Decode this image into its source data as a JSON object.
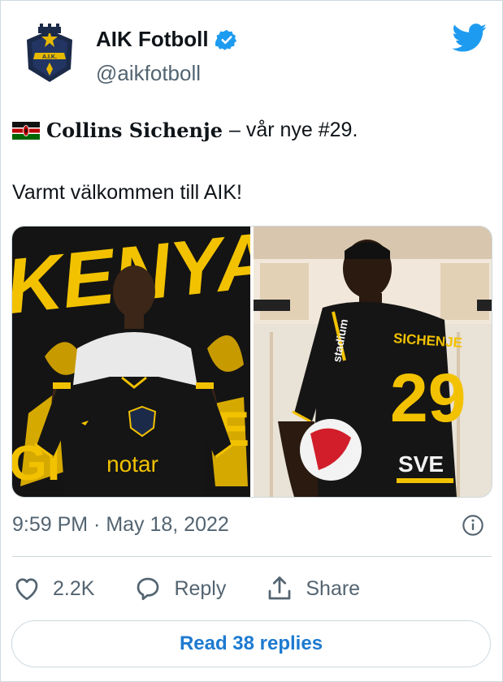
{
  "author": {
    "name": "AIK Fotboll",
    "handle": "@aikfotboll",
    "verified_icon": "verified-badge-icon"
  },
  "tweet": {
    "flag_icon": "kenya-flag-icon",
    "player_name": "Collins Sichenje",
    "line1_rest": "– vår nye #29.",
    "line2": "Varmt välkommen till AIK!"
  },
  "media": {
    "left": {
      "banner_text": "KENYA",
      "shirt_sponsor": "notar"
    },
    "right": {
      "shirt_name": "SICHENJE",
      "shirt_number": "29",
      "sleeve_text": "stadium",
      "sponsor_fragment": "SVE"
    }
  },
  "meta": {
    "timestamp": "9:59 PM · May 18, 2022"
  },
  "actions": {
    "likes": "2.2K",
    "reply_label": "Reply",
    "share_label": "Share"
  },
  "read_replies": "Read 38 replies",
  "colors": {
    "link_blue": "#1d7ad0",
    "twitter_blue": "#1d9bf0",
    "secondary": "#536471",
    "border": "#cfd9de",
    "aik_yellow": "#f5c400",
    "aik_black": "#111111"
  }
}
